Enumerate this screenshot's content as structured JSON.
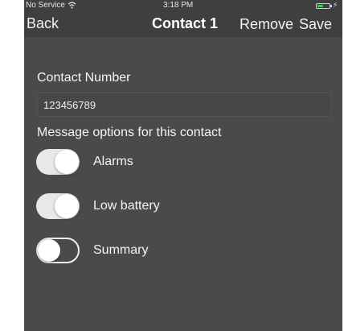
{
  "status_bar": {
    "carrier": "No Service",
    "time": "3:18 PM",
    "battery_level": 0.5,
    "battery_color": "#35d04b",
    "wifi_icon": "wifi-icon",
    "charging_icon": "charging-bolt-icon"
  },
  "navbar": {
    "back_label": "Back",
    "title": "Contact 1",
    "remove_label": "Remove",
    "save_label": "Save"
  },
  "form": {
    "contact_number_label": "Contact Number",
    "contact_number_value": "123456789",
    "message_options_label": "Message options for this contact"
  },
  "options": [
    {
      "label": "Alarms",
      "enabled": true
    },
    {
      "label": "Low battery",
      "enabled": true
    },
    {
      "label": "Summary",
      "enabled": false
    }
  ],
  "colors": {
    "background": "#4a4a4a",
    "navbar": "#3f3f3f",
    "text": "#f4f4f4",
    "toggle_on": "#e8e8e8"
  }
}
